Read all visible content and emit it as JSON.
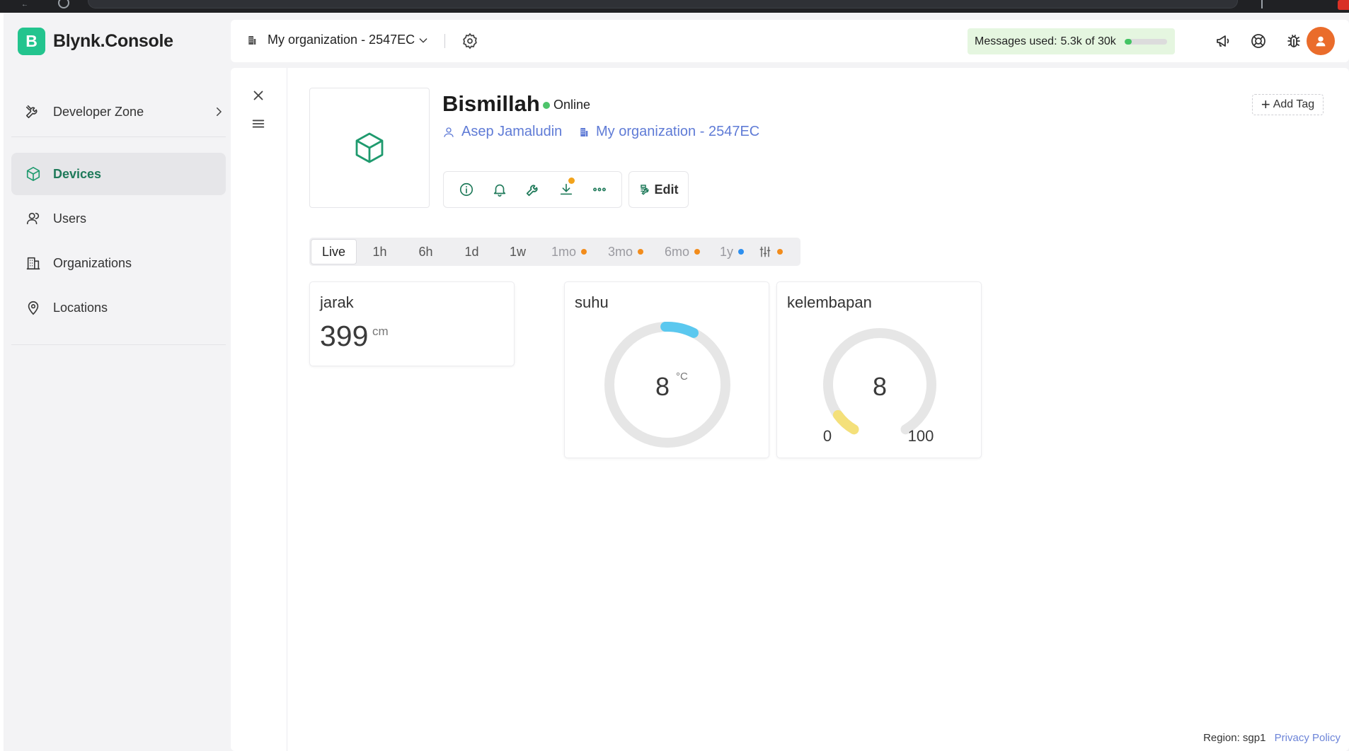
{
  "app": {
    "brand_letter": "B",
    "brand_name": "Blynk.Console"
  },
  "sidebar": {
    "developer_zone": "Developer Zone",
    "items": [
      {
        "label": "Devices",
        "icon": "cube-icon",
        "active": true
      },
      {
        "label": "Users",
        "icon": "users-icon"
      },
      {
        "label": "Organizations",
        "icon": "building-icon"
      },
      {
        "label": "Locations",
        "icon": "location-pin-icon"
      }
    ]
  },
  "header": {
    "org_name": "My organization - 2547EC",
    "messages_label": "Messages used:",
    "messages_value": "5.3k of 30k",
    "messages_fraction": 0.177
  },
  "device": {
    "name": "Bismillah",
    "status": "Online",
    "owner": "Asep Jamaludin",
    "organization": "My organization - 2547EC",
    "edit_label": "Edit",
    "add_tag_label": "Add Tag"
  },
  "time_ranges": [
    {
      "label": "Live",
      "active": true
    },
    {
      "label": "1h"
    },
    {
      "label": "6h"
    },
    {
      "label": "1d"
    },
    {
      "label": "1w"
    },
    {
      "label": "1mo",
      "dot": "#f28c1c"
    },
    {
      "label": "3mo",
      "dot": "#f28c1c"
    },
    {
      "label": "6mo",
      "dot": "#f28c1c"
    },
    {
      "label": "1y",
      "dot": "#2d8fef"
    }
  ],
  "range_settings_dot": "#f28c1c",
  "widgets": {
    "jarak": {
      "title": "jarak",
      "value": "399",
      "unit": "cm"
    },
    "suhu": {
      "title": "suhu",
      "value": "8",
      "unit": "°C",
      "fraction": 0.08,
      "color": "#5bc8ef"
    },
    "kelembapan": {
      "title": "kelembapan",
      "value": "8",
      "min": "0",
      "max": "100",
      "fraction": 0.08,
      "color": "#f4e07a"
    }
  },
  "footer": {
    "region": "Region: sgp1",
    "privacy": "Privacy Policy"
  },
  "colors": {
    "brand": "#23c48e",
    "accent_green": "#1f7a5a",
    "link_blue": "#5f7bd6",
    "avatar": "#ea6c2b"
  }
}
